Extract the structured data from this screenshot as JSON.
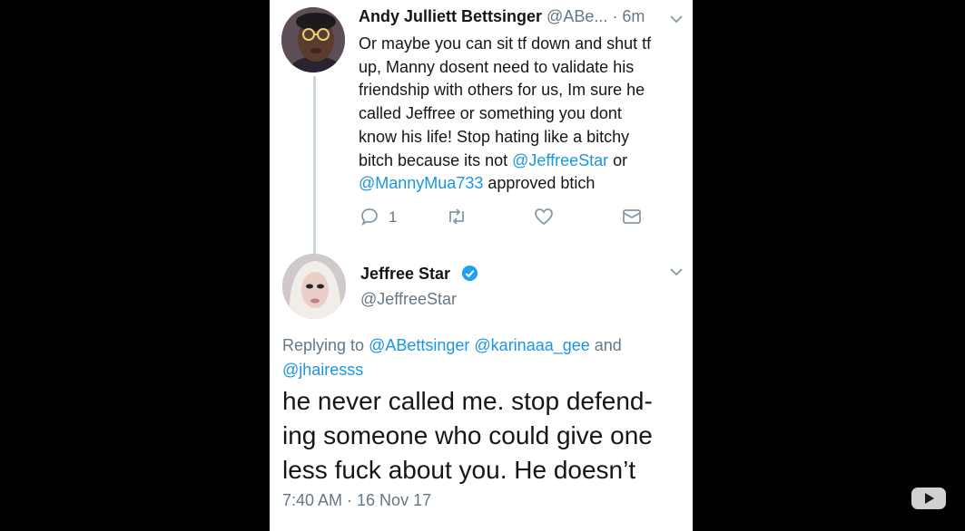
{
  "tweet_1": {
    "name": "Andy Julliett Bettsinger",
    "handle": "@ABe...",
    "separator": "·",
    "time": "6m",
    "body_lines": [
      [
        {
          "t": "Or maybe you can sit tf down and shut tf"
        }
      ],
      [
        {
          "t": "up, Manny dosent need to validate his"
        }
      ],
      [
        {
          "t": "friendship with others for us, Im sure he"
        }
      ],
      [
        {
          "t": "called Jeffree or something you dont"
        }
      ],
      [
        {
          "t": "know his life! Stop hating like a bitchy"
        }
      ],
      [
        {
          "t": "bitch because its not "
        },
        {
          "t": "@JeffreeStar",
          "mention": true
        },
        {
          "t": " or"
        }
      ],
      [
        {
          "t": "@MannyMua733",
          "mention": true
        },
        {
          "t": " approved btich"
        }
      ]
    ],
    "actions": {
      "reply_icon": "reply-icon",
      "reply_count": "1",
      "retweet_icon": "retweet-icon",
      "like_icon": "heart-icon",
      "dm_icon": "envelope-icon"
    }
  },
  "tweet_2": {
    "name": "Jeffree Star",
    "handle": "@JeffreeStar",
    "verified": true,
    "replying_lines": [
      [
        {
          "t": "Replying to "
        },
        {
          "t": "@ABettsinger",
          "mention": true
        },
        {
          "t": " "
        },
        {
          "t": "@karinaaa_gee",
          "mention": true
        },
        {
          "t": " and"
        }
      ],
      [
        {
          "t": "@jhairesss",
          "mention": true
        }
      ]
    ],
    "body_lines": [
      "he never called me. stop defend-",
      "ing someone who could give one",
      "less fuck about you. He doesn’t"
    ],
    "timestamp": "7:40 AM · 16 Nov 17"
  },
  "colors": {
    "mention": "#1b95e0",
    "secondary_text": "#657786",
    "primary_text": "#14171a",
    "thread_line": "#c9d6df",
    "verified_badge": "#1da1f2"
  },
  "overlay": {
    "logo_icon": "youtube-logo-icon"
  }
}
